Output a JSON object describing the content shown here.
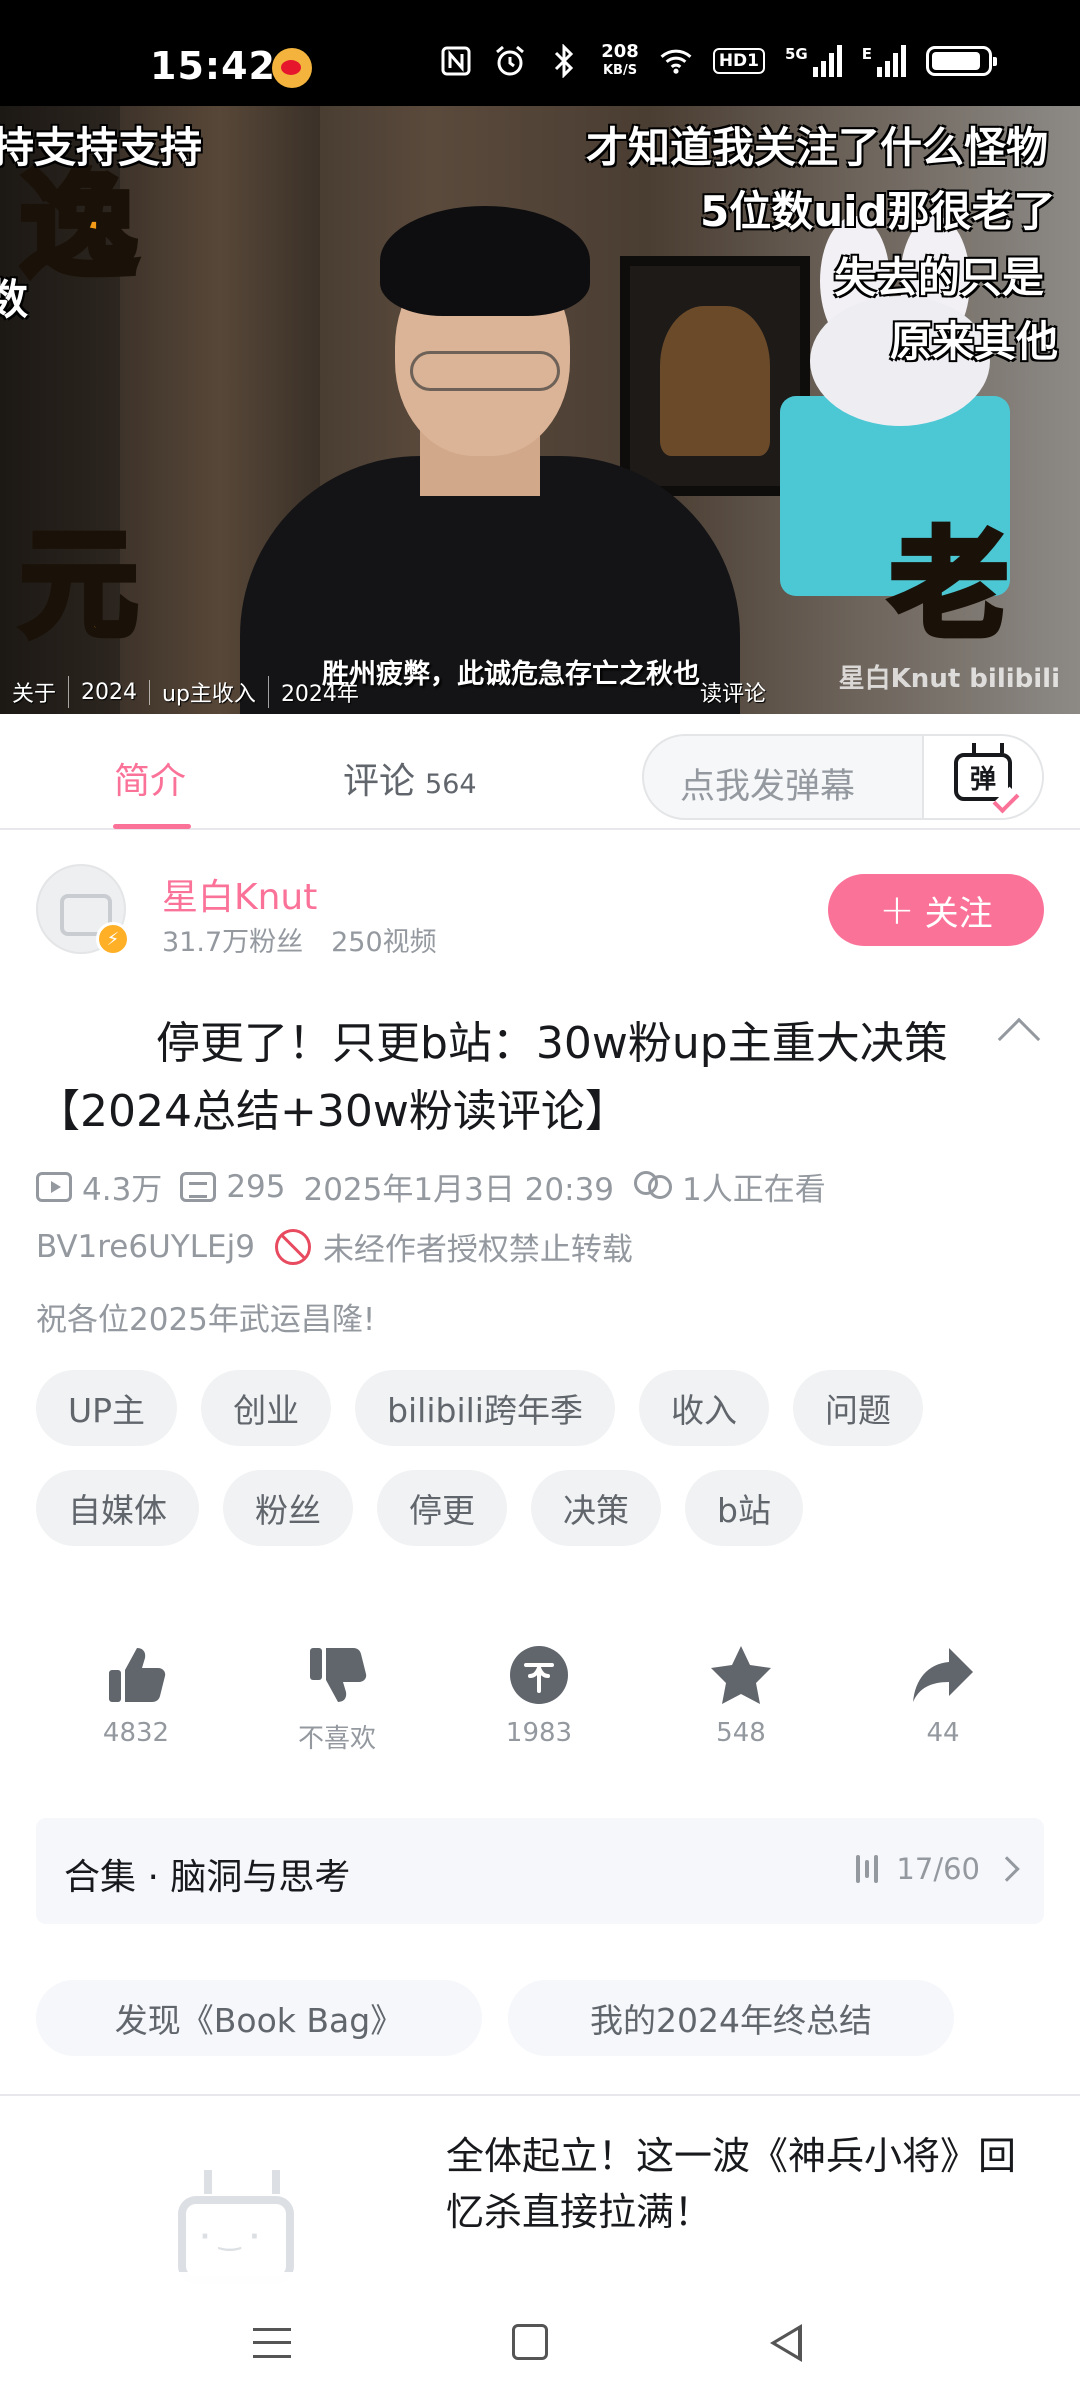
{
  "status_bar": {
    "time": "15:42",
    "net_speed_value": "208",
    "net_speed_unit": "KB/S",
    "hd_label": "HD1",
    "signal_1_label": "5G",
    "signal_2_label": "E",
    "battery_level": 0.88,
    "icons": [
      "weibo-icon",
      "nfc-icon",
      "alarm-icon",
      "bluetooth-icon",
      "wifi-icon",
      "signal-icon",
      "battery-icon"
    ]
  },
  "player": {
    "danmaku": [
      "持支持支持",
      "才知道我关注了什么怪物",
      "5位数uid那很老了",
      "失去的只是",
      "原来其他",
      "数"
    ],
    "deco_chars": [
      "逸",
      "元",
      "老"
    ],
    "subtitle": "胜州疲弊，此诚危急存亡之秋也",
    "watermark": "星白Knut bilibili",
    "chapter_tags": [
      "关于",
      "2024",
      "up主收入",
      "2024年"
    ],
    "chapter_extra": "读评论"
  },
  "tabs": {
    "intro_label": "简介",
    "comments_label": "评论",
    "comments_count": "564",
    "danmaku_placeholder": "点我发弹幕",
    "danmaku_button_glyph": "弹"
  },
  "uploader": {
    "name": "星白Knut",
    "fans": "31.7万粉丝",
    "videos": "250视频",
    "follow_label": "关注",
    "follow_plus": "+"
  },
  "video": {
    "title": "停更了！只更b站：30w粉up主重大决策【2024总结+30w粉读评论】",
    "views": "4.3万",
    "danmaku_count": "295",
    "date": "2025年1月3日 20:39",
    "watching": "1人正在看",
    "bvid": "BV1re6UYLEj9",
    "copyright": "未经作者授权禁止转载",
    "description": "祝各位2025年武运昌隆!"
  },
  "tags": [
    "UP主",
    "创业",
    "bilibili跨年季",
    "收入",
    "问题",
    "自媒体",
    "粉丝",
    "停更",
    "决策",
    "b站"
  ],
  "actions": {
    "like": "4832",
    "dislike": "不喜欢",
    "coin": "1983",
    "favorite": "548",
    "share": "44"
  },
  "collection": {
    "label": "合集 · 脑洞与思考",
    "progress": "17/60"
  },
  "related_chips": [
    "发现《Book Bag》",
    "我的2024年终总结"
  ],
  "recommendation": {
    "title": "全体起立！这一波《神兵小将》回忆杀直接拉满！"
  },
  "colors": {
    "brand_pink": "#fb7299",
    "text_primary": "#18191c",
    "text_secondary": "#9499a0",
    "tag_bg": "#f1f2f3"
  }
}
